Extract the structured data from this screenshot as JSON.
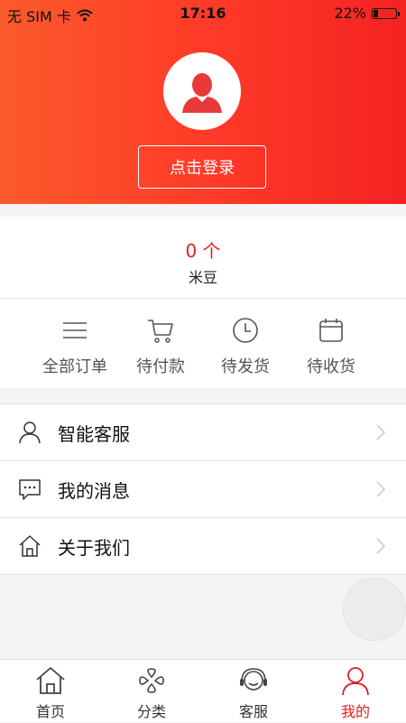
{
  "status_bar": {
    "carrier": "无 SIM 卡",
    "time": "17:16",
    "battery_text": "22%",
    "battery_level": 0.22
  },
  "header": {
    "login_label": "点击登录"
  },
  "points": {
    "value": "0 个",
    "label": "米豆"
  },
  "orders": [
    {
      "label": "全部订单",
      "icon": "list-icon"
    },
    {
      "label": "待付款",
      "icon": "cart-icon"
    },
    {
      "label": "待发货",
      "icon": "clock-icon"
    },
    {
      "label": "待收货",
      "icon": "calendar-icon"
    }
  ],
  "menu": [
    {
      "label": "智能客服",
      "icon": "person-icon"
    },
    {
      "label": "我的消息",
      "icon": "message-icon"
    },
    {
      "label": "关于我们",
      "icon": "home-icon"
    }
  ],
  "tabbar": [
    {
      "label": "首页",
      "icon": "home-icon",
      "active": false
    },
    {
      "label": "分类",
      "icon": "category-icon",
      "active": false
    },
    {
      "label": "客服",
      "icon": "headset-icon",
      "active": false
    },
    {
      "label": "我的",
      "icon": "user-icon",
      "active": true
    }
  ],
  "colors": {
    "accent": "#e02020",
    "header_start": "#fb5a2c",
    "header_end": "#f52222"
  }
}
